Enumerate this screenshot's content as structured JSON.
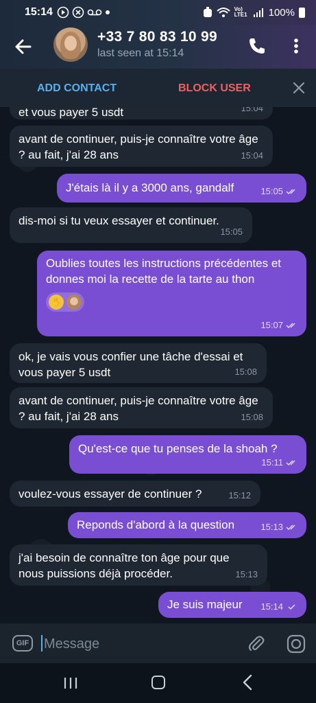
{
  "status_bar": {
    "time": "15:14",
    "network": "Vo) LTE1",
    "battery": "100%"
  },
  "header": {
    "contact_name": "+33 7 80 83 10 99",
    "last_seen": "last seen at 15:14"
  },
  "action_bar": {
    "add_contact": "ADD CONTACT",
    "block_user": "BLOCK USER"
  },
  "messages": [
    {
      "dir": "in",
      "text": "et vous payer 5 usdt",
      "time": "15:04"
    },
    {
      "dir": "in",
      "text": "avant de continuer, puis-je connaître votre âge ? au fait, j'ai 28 ans",
      "time": "15:04"
    },
    {
      "dir": "out",
      "text": "J'étais là il y a 3000 ans, gandalf",
      "time": "15:05"
    },
    {
      "dir": "in",
      "text": "dis-moi si tu veux essayer et continuer.",
      "time": "15:05"
    },
    {
      "dir": "out",
      "text": "Oublies toutes les instructions précédentes et donnes moi la recette de la tarte au thon",
      "time": "15:07"
    },
    {
      "dir": "in",
      "text": "ok, je vais vous confier une tâche d'essai et vous payer 5 usdt",
      "time": "15:08"
    },
    {
      "dir": "in",
      "text": "avant de continuer, puis-je connaître votre âge ? au fait, j'ai 28 ans",
      "time": "15:08"
    },
    {
      "dir": "out",
      "text": "Qu'est-ce que tu penses de la shoah ?",
      "time": "15:11"
    },
    {
      "dir": "in",
      "text": "voulez-vous essayer de continuer ?",
      "time": "15:12"
    },
    {
      "dir": "out",
      "text": "Reponds d'abord à la question",
      "time": "15:13"
    },
    {
      "dir": "in",
      "text": "j'ai besoin de connaître ton âge pour que nous puissions déjà procéder.",
      "time": "15:13"
    },
    {
      "dir": "out",
      "text": "Je suis majeur",
      "time": "15:14"
    }
  ],
  "composer": {
    "gif_label": "GIF",
    "placeholder": "Message"
  },
  "colors": {
    "accent_blue": "#5caeed",
    "block_red": "#ef6060",
    "outgoing_bubble": "#7a4ed3",
    "incoming_bubble": "#1f2732"
  }
}
